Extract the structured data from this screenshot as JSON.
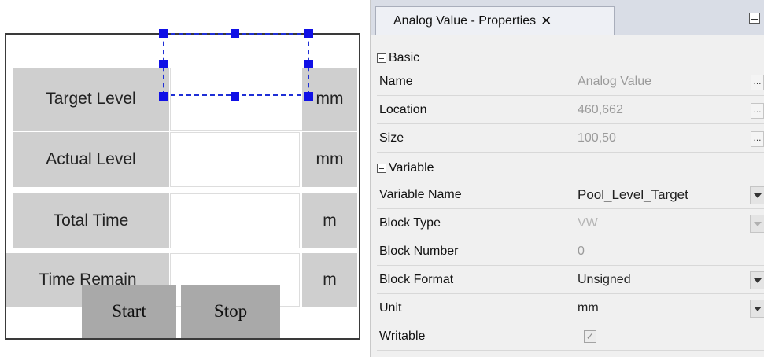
{
  "hmi": {
    "rows": [
      {
        "label": "Target Level",
        "unit": "mm"
      },
      {
        "label": "Actual Level",
        "unit": "mm"
      },
      {
        "label": "Total Time",
        "unit": "m"
      },
      {
        "label": "Time Remain",
        "unit": "m"
      }
    ],
    "buttons": {
      "start": "Start",
      "stop": "Stop"
    }
  },
  "properties_panel": {
    "tab_title": "Analog Value - Properties",
    "tab_close": "✕",
    "categories": {
      "basic": "Basic",
      "variable": "Variable"
    },
    "basic": [
      {
        "name": "Name",
        "value": "Analog Value"
      },
      {
        "name": "Location",
        "value": "460,662"
      },
      {
        "name": "Size",
        "value": "100,50"
      }
    ],
    "variable": [
      {
        "name": "Variable Name",
        "value": "Pool_Level_Target"
      },
      {
        "name": "Block Type",
        "value": "VW"
      },
      {
        "name": "Block Number",
        "value": "0"
      },
      {
        "name": "Block Format",
        "value": "Unsigned"
      },
      {
        "name": "Unit",
        "value": "mm"
      },
      {
        "name": "Writable",
        "value": "✓"
      }
    ],
    "ellipsis": "..."
  },
  "colors": {
    "selection": "#1f2fd6",
    "label_bg": "#cfcfcf",
    "button_bg": "#a9a9a9"
  }
}
